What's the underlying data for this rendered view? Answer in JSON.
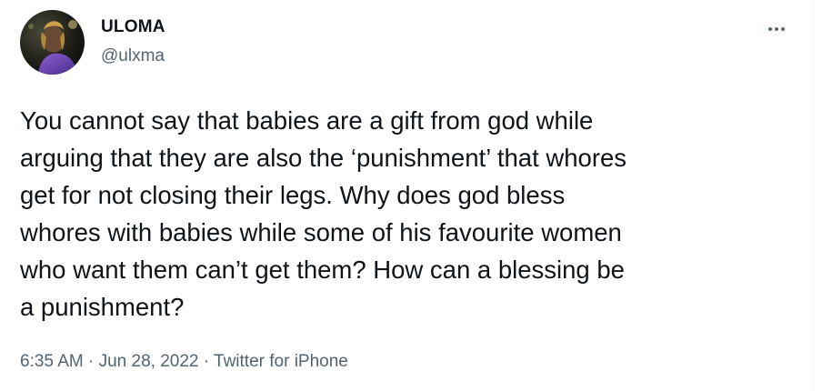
{
  "author": {
    "display_name": "ULOMA",
    "handle": "@ulxma",
    "avatar_icon": "profile-photo"
  },
  "menu": {
    "icon": "more-horizontal-icon"
  },
  "tweet": {
    "text": "You cannot say that babies are a gift from god while\narguing that they are also the ‘punishment’ that whores\nget for not closing their legs. Why does god bless\nwhores with babies while some of his favourite women\nwho want them can’t get them? How can a blessing be\na punishment?"
  },
  "meta": {
    "time": "6:35 AM",
    "separator": "·",
    "date": "Jun 28, 2022",
    "source": "Twitter for iPhone"
  },
  "colors": {
    "text_primary": "#0f1419",
    "text_secondary": "#536471",
    "background": "#ffffff"
  }
}
